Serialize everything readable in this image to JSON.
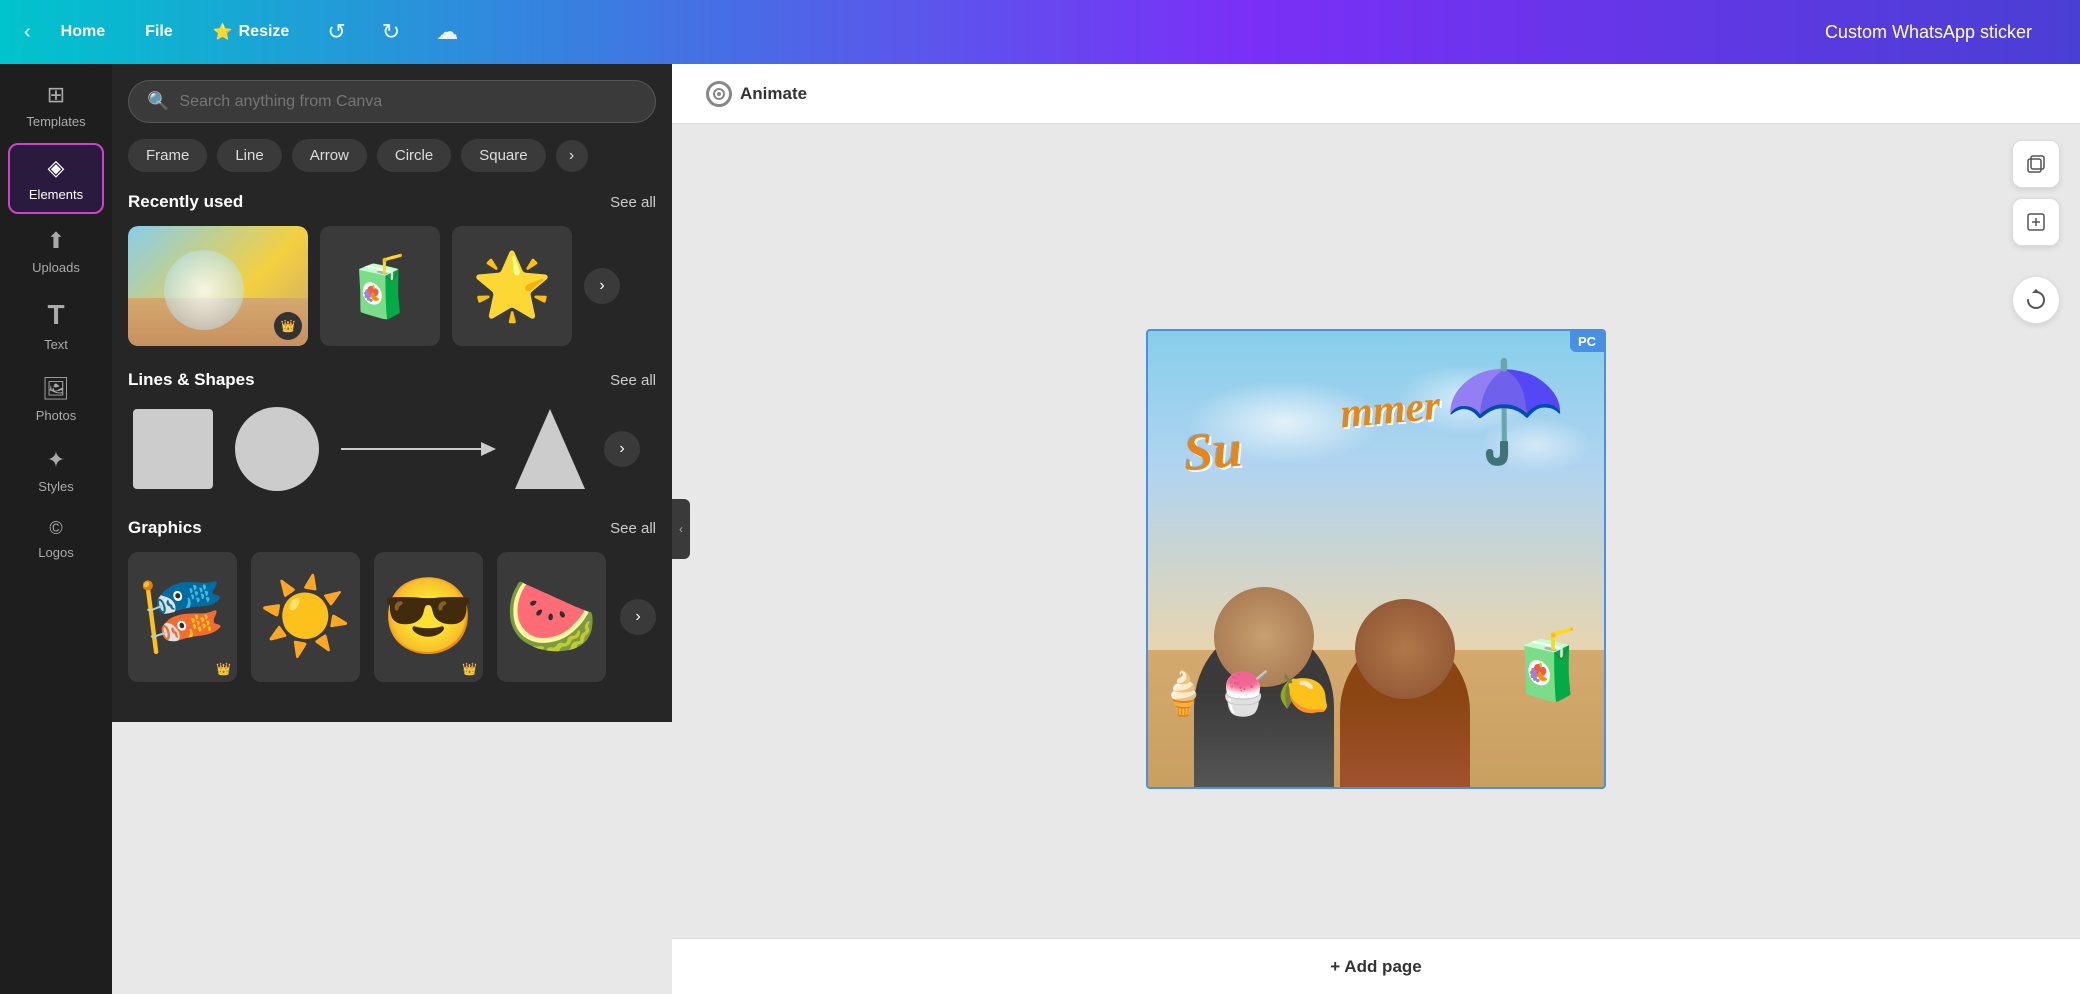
{
  "header": {
    "back_label": "‹",
    "home_label": "Home",
    "file_label": "File",
    "resize_label": "Resize",
    "resize_icon": "⭐",
    "undo_icon": "↺",
    "redo_icon": "↻",
    "cloud_icon": "☁",
    "title": "Custom WhatsApp sticker"
  },
  "sidebar": {
    "items": [
      {
        "id": "templates",
        "label": "Templates",
        "icon": "⊞"
      },
      {
        "id": "elements",
        "label": "Elements",
        "icon": "◈",
        "active": true
      },
      {
        "id": "uploads",
        "label": "Uploads",
        "icon": "⬆"
      },
      {
        "id": "text",
        "label": "Text",
        "icon": "T"
      },
      {
        "id": "photos",
        "label": "Photos",
        "icon": "🖼"
      },
      {
        "id": "styles",
        "label": "Styles",
        "icon": "✦"
      },
      {
        "id": "logos",
        "label": "Logos",
        "icon": "©"
      }
    ]
  },
  "search": {
    "placeholder": "Search anything from Canva"
  },
  "filters": {
    "chips": [
      "Frame",
      "Line",
      "Arrow",
      "Circle",
      "Square"
    ],
    "more_icon": "›"
  },
  "recently_used": {
    "title": "Recently used",
    "see_all": "See all",
    "items": [
      {
        "type": "beach",
        "label": "Beach photo"
      },
      {
        "type": "drink",
        "emoji": "🧃",
        "label": "Drink sticker"
      },
      {
        "type": "sun",
        "emoji": "✨",
        "label": "Sun sticker"
      }
    ]
  },
  "lines_shapes": {
    "title": "Lines & Shapes",
    "see_all": "See all"
  },
  "graphics": {
    "title": "Graphics",
    "see_all": "See all",
    "items": [
      {
        "emoji": "🎏",
        "crown": true
      },
      {
        "emoji": "☀️",
        "crown": false
      },
      {
        "emoji": "😎",
        "crown": true
      },
      {
        "emoji": "🍉",
        "crown": false
      }
    ]
  },
  "canvas": {
    "animate_label": "Animate",
    "pc_badge": "PC",
    "add_page_label": "+ Add page",
    "summer_text": "Summer",
    "summer_text2": "mmer"
  }
}
